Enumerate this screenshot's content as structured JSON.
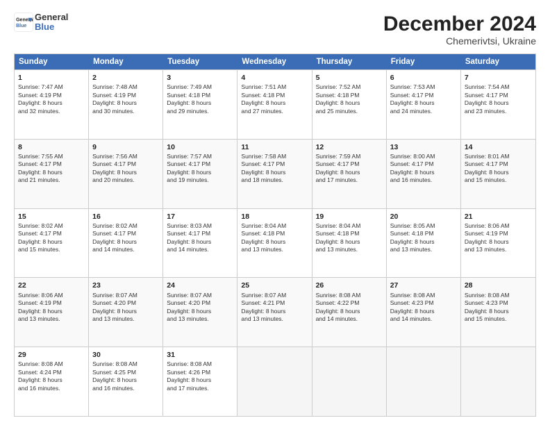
{
  "header": {
    "logo_line1": "General",
    "logo_line2": "Blue",
    "title": "December 2024",
    "subtitle": "Chemerivtsi, Ukraine"
  },
  "calendar": {
    "weekdays": [
      "Sunday",
      "Monday",
      "Tuesday",
      "Wednesday",
      "Thursday",
      "Friday",
      "Saturday"
    ],
    "rows": [
      [
        {
          "day": "1",
          "lines": [
            "Sunrise: 7:47 AM",
            "Sunset: 4:19 PM",
            "Daylight: 8 hours",
            "and 32 minutes."
          ]
        },
        {
          "day": "2",
          "lines": [
            "Sunrise: 7:48 AM",
            "Sunset: 4:19 PM",
            "Daylight: 8 hours",
            "and 30 minutes."
          ]
        },
        {
          "day": "3",
          "lines": [
            "Sunrise: 7:49 AM",
            "Sunset: 4:18 PM",
            "Daylight: 8 hours",
            "and 29 minutes."
          ]
        },
        {
          "day": "4",
          "lines": [
            "Sunrise: 7:51 AM",
            "Sunset: 4:18 PM",
            "Daylight: 8 hours",
            "and 27 minutes."
          ]
        },
        {
          "day": "5",
          "lines": [
            "Sunrise: 7:52 AM",
            "Sunset: 4:18 PM",
            "Daylight: 8 hours",
            "and 25 minutes."
          ]
        },
        {
          "day": "6",
          "lines": [
            "Sunrise: 7:53 AM",
            "Sunset: 4:17 PM",
            "Daylight: 8 hours",
            "and 24 minutes."
          ]
        },
        {
          "day": "7",
          "lines": [
            "Sunrise: 7:54 AM",
            "Sunset: 4:17 PM",
            "Daylight: 8 hours",
            "and 23 minutes."
          ]
        }
      ],
      [
        {
          "day": "8",
          "lines": [
            "Sunrise: 7:55 AM",
            "Sunset: 4:17 PM",
            "Daylight: 8 hours",
            "and 21 minutes."
          ]
        },
        {
          "day": "9",
          "lines": [
            "Sunrise: 7:56 AM",
            "Sunset: 4:17 PM",
            "Daylight: 8 hours",
            "and 20 minutes."
          ]
        },
        {
          "day": "10",
          "lines": [
            "Sunrise: 7:57 AM",
            "Sunset: 4:17 PM",
            "Daylight: 8 hours",
            "and 19 minutes."
          ]
        },
        {
          "day": "11",
          "lines": [
            "Sunrise: 7:58 AM",
            "Sunset: 4:17 PM",
            "Daylight: 8 hours",
            "and 18 minutes."
          ]
        },
        {
          "day": "12",
          "lines": [
            "Sunrise: 7:59 AM",
            "Sunset: 4:17 PM",
            "Daylight: 8 hours",
            "and 17 minutes."
          ]
        },
        {
          "day": "13",
          "lines": [
            "Sunrise: 8:00 AM",
            "Sunset: 4:17 PM",
            "Daylight: 8 hours",
            "and 16 minutes."
          ]
        },
        {
          "day": "14",
          "lines": [
            "Sunrise: 8:01 AM",
            "Sunset: 4:17 PM",
            "Daylight: 8 hours",
            "and 15 minutes."
          ]
        }
      ],
      [
        {
          "day": "15",
          "lines": [
            "Sunrise: 8:02 AM",
            "Sunset: 4:17 PM",
            "Daylight: 8 hours",
            "and 15 minutes."
          ]
        },
        {
          "day": "16",
          "lines": [
            "Sunrise: 8:02 AM",
            "Sunset: 4:17 PM",
            "Daylight: 8 hours",
            "and 14 minutes."
          ]
        },
        {
          "day": "17",
          "lines": [
            "Sunrise: 8:03 AM",
            "Sunset: 4:17 PM",
            "Daylight: 8 hours",
            "and 14 minutes."
          ]
        },
        {
          "day": "18",
          "lines": [
            "Sunrise: 8:04 AM",
            "Sunset: 4:18 PM",
            "Daylight: 8 hours",
            "and 13 minutes."
          ]
        },
        {
          "day": "19",
          "lines": [
            "Sunrise: 8:04 AM",
            "Sunset: 4:18 PM",
            "Daylight: 8 hours",
            "and 13 minutes."
          ]
        },
        {
          "day": "20",
          "lines": [
            "Sunrise: 8:05 AM",
            "Sunset: 4:18 PM",
            "Daylight: 8 hours",
            "and 13 minutes."
          ]
        },
        {
          "day": "21",
          "lines": [
            "Sunrise: 8:06 AM",
            "Sunset: 4:19 PM",
            "Daylight: 8 hours",
            "and 13 minutes."
          ]
        }
      ],
      [
        {
          "day": "22",
          "lines": [
            "Sunrise: 8:06 AM",
            "Sunset: 4:19 PM",
            "Daylight: 8 hours",
            "and 13 minutes."
          ]
        },
        {
          "day": "23",
          "lines": [
            "Sunrise: 8:07 AM",
            "Sunset: 4:20 PM",
            "Daylight: 8 hours",
            "and 13 minutes."
          ]
        },
        {
          "day": "24",
          "lines": [
            "Sunrise: 8:07 AM",
            "Sunset: 4:20 PM",
            "Daylight: 8 hours",
            "and 13 minutes."
          ]
        },
        {
          "day": "25",
          "lines": [
            "Sunrise: 8:07 AM",
            "Sunset: 4:21 PM",
            "Daylight: 8 hours",
            "and 13 minutes."
          ]
        },
        {
          "day": "26",
          "lines": [
            "Sunrise: 8:08 AM",
            "Sunset: 4:22 PM",
            "Daylight: 8 hours",
            "and 14 minutes."
          ]
        },
        {
          "day": "27",
          "lines": [
            "Sunrise: 8:08 AM",
            "Sunset: 4:23 PM",
            "Daylight: 8 hours",
            "and 14 minutes."
          ]
        },
        {
          "day": "28",
          "lines": [
            "Sunrise: 8:08 AM",
            "Sunset: 4:23 PM",
            "Daylight: 8 hours",
            "and 15 minutes."
          ]
        }
      ],
      [
        {
          "day": "29",
          "lines": [
            "Sunrise: 8:08 AM",
            "Sunset: 4:24 PM",
            "Daylight: 8 hours",
            "and 16 minutes."
          ]
        },
        {
          "day": "30",
          "lines": [
            "Sunrise: 8:08 AM",
            "Sunset: 4:25 PM",
            "Daylight: 8 hours",
            "and 16 minutes."
          ]
        },
        {
          "day": "31",
          "lines": [
            "Sunrise: 8:08 AM",
            "Sunset: 4:26 PM",
            "Daylight: 8 hours",
            "and 17 minutes."
          ]
        },
        {
          "day": "",
          "lines": []
        },
        {
          "day": "",
          "lines": []
        },
        {
          "day": "",
          "lines": []
        },
        {
          "day": "",
          "lines": []
        }
      ]
    ]
  }
}
